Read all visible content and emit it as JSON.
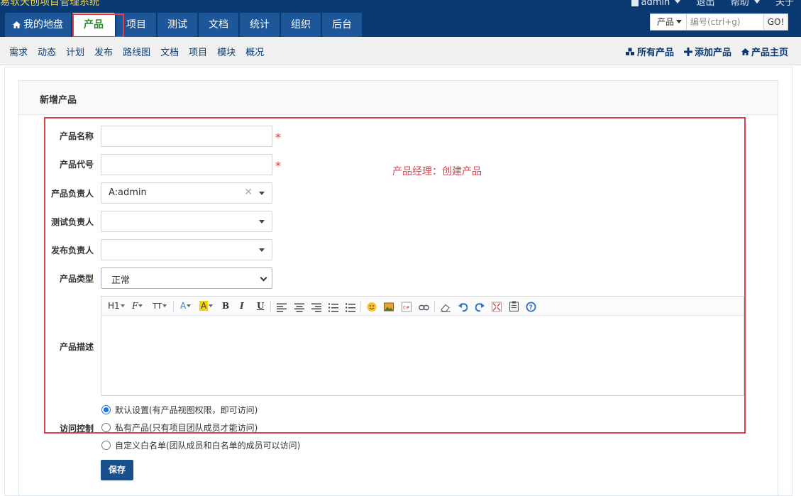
{
  "app": {
    "title": "易软天创项目管理系统",
    "user": "admin",
    "logout": "退出",
    "help": "帮助",
    "about": "关于"
  },
  "main_tabs": [
    "我的地盘",
    "产品",
    "项目",
    "测试",
    "文档",
    "统计",
    "组织",
    "后台"
  ],
  "search": {
    "type": "产品",
    "placeholder": "编号(ctrl+g)",
    "go": "GO!"
  },
  "subnav": {
    "left": [
      "需求",
      "动态",
      "计划",
      "发布",
      "路线图",
      "文档",
      "项目",
      "模块",
      "概况"
    ],
    "right": [
      "所有产品",
      "添加产品",
      "产品主页"
    ]
  },
  "form": {
    "title": "新增产品",
    "annotation": "产品经理：创建产品",
    "fields": {
      "name_label": "产品名称",
      "code_label": "产品代号",
      "po_label": "产品负责人",
      "po_value": "A:admin",
      "qd_label": "测试负责人",
      "rd_label": "发布负责人",
      "type_label": "产品类型",
      "type_value": "正常",
      "desc_label": "产品描述",
      "acl_label": "访问控制"
    },
    "required_mark": "*",
    "editor_toolbar": [
      "H1",
      "F",
      "TT",
      "A",
      "A",
      "B",
      "I",
      "U"
    ],
    "acl_options": [
      "默认设置(有产品视图权限，即可访问)",
      "私有产品(只有项目团队成员才能访问)",
      "自定义白名单(团队成员和白名单的成员可以访问)"
    ],
    "save": "保存"
  },
  "colors": {
    "header": "#0b3a72",
    "tab": "#1e5799",
    "active_tab_text": "#2a8a2a",
    "highlight": "#e0404a",
    "primary_button": "#1b4f8c"
  }
}
